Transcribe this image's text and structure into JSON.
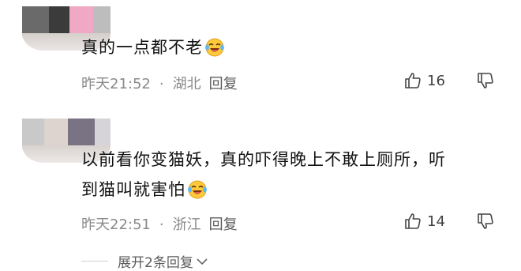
{
  "comments": [
    {
      "text": "真的一点都不老",
      "meta_time": "昨天21:52",
      "meta_location": "湖北",
      "reply_label": "回复",
      "like_count": "16"
    },
    {
      "text_line1": "以前看你变猫妖，真的吓得晚上不敢上厕所，听",
      "text_line2": "到猫叫就害怕",
      "meta_time": "昨天22:51",
      "meta_location": "浙江",
      "reply_label": "回复",
      "like_count": "14"
    }
  ],
  "separator": "·",
  "expand_label": "展开2条回复",
  "icons": {
    "emoji": "crying-laughing-emoji",
    "like": "thumbs-up-icon",
    "dislike": "thumbs-down-icon",
    "expand": "chevron-down-icon"
  },
  "colors": {
    "meta_gray": "#8a8a8a",
    "text": "#111111",
    "emoji_yellow": "#ffc93a"
  }
}
